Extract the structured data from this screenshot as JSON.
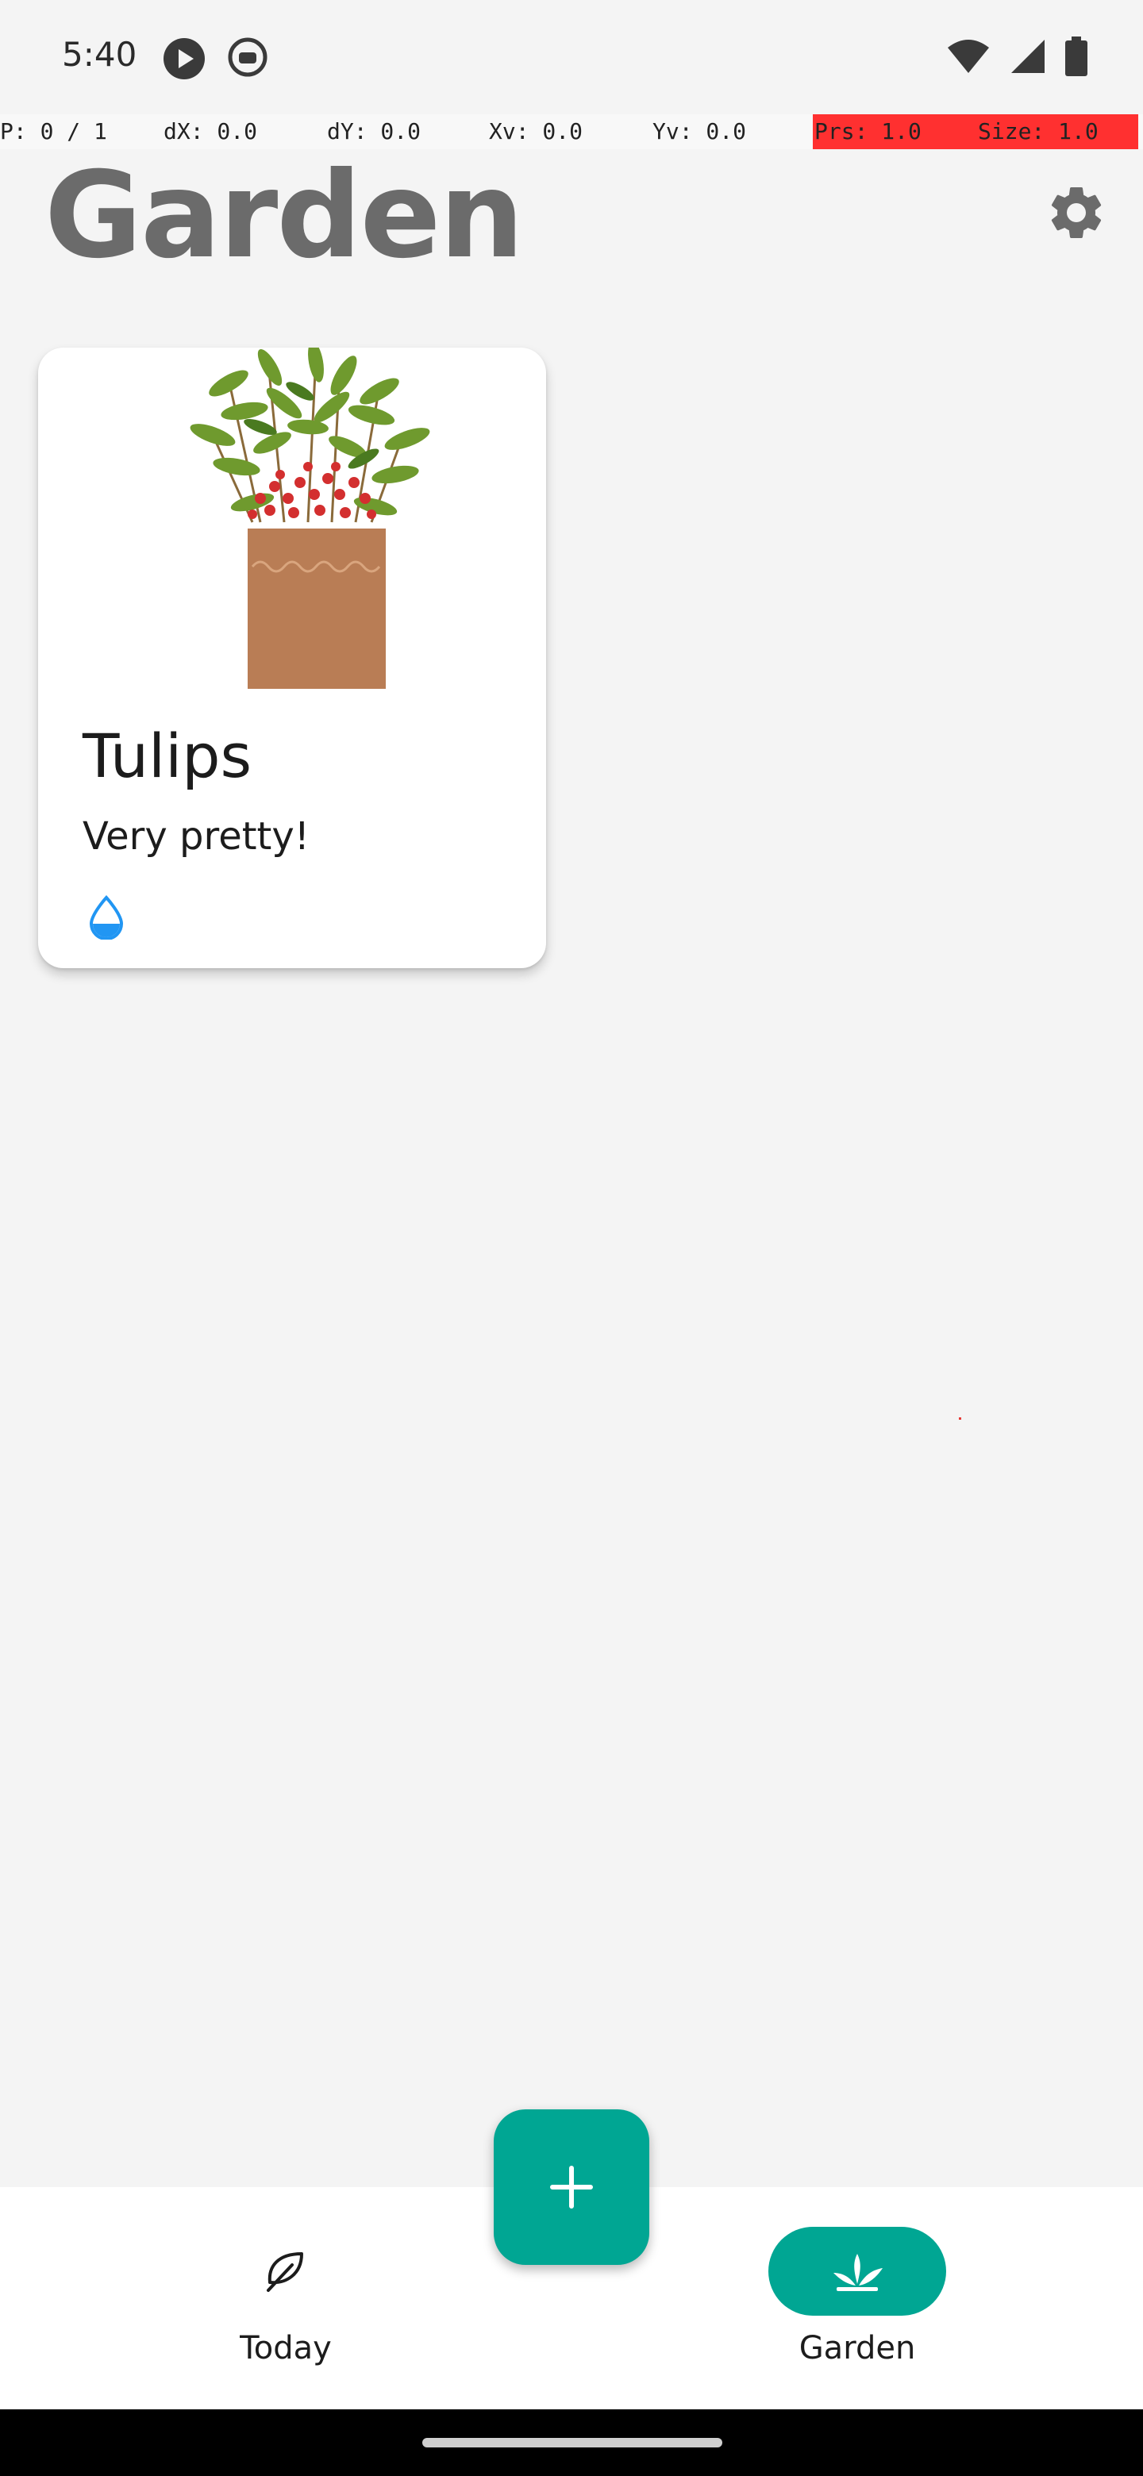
{
  "status_bar": {
    "time": "5:40"
  },
  "pointer_overlay": {
    "p": "P: 0 / 1",
    "dx": "dX: 0.0",
    "dy": "dY: 0.0",
    "xv": "Xv: 0.0",
    "yv": "Yv: 0.0",
    "prs": "Prs: 1.0",
    "size": "Size: 1.0"
  },
  "header": {
    "title": "Garden"
  },
  "plants": [
    {
      "name": "Tulips",
      "description": "Very pretty!"
    }
  ],
  "bottom_nav": {
    "items": [
      {
        "label": "Today",
        "icon": "leaf-icon",
        "active": false
      },
      {
        "label": "Garden",
        "icon": "garden-icon",
        "active": true
      }
    ]
  },
  "colors": {
    "accent": "#00a693",
    "background": "#f4f4f4",
    "water": "#2196f3",
    "overlay_red": "#ff3030"
  }
}
